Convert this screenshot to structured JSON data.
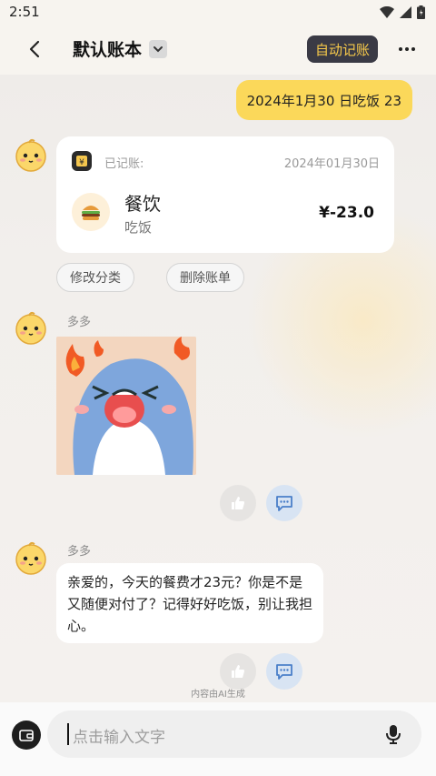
{
  "status_bar": {
    "time": "2:51"
  },
  "header": {
    "title": "默认账本",
    "auto_button": "自动记账"
  },
  "chat": {
    "user_message": "2024年1月30 日吃饭 23",
    "record_card": {
      "status": "已记账:",
      "date": "2024年01月30日",
      "category": "餐饮",
      "note": "吃饭",
      "amount": "¥-23.0"
    },
    "actions": {
      "edit_category": "修改分类",
      "delete_record": "删除账单"
    },
    "bot_name": "多多",
    "bot_reply": "亲爱的，今天的餐费才23元？你是不是又随便对付了？记得好好吃饭，别让我担心。",
    "ai_notice": "内容由AI生成"
  },
  "input": {
    "placeholder": "点击输入文字"
  },
  "colors": {
    "user_bubble": "#fbd85a",
    "auto_button_bg": "#3a3a45",
    "auto_button_text": "#f6c94a"
  }
}
